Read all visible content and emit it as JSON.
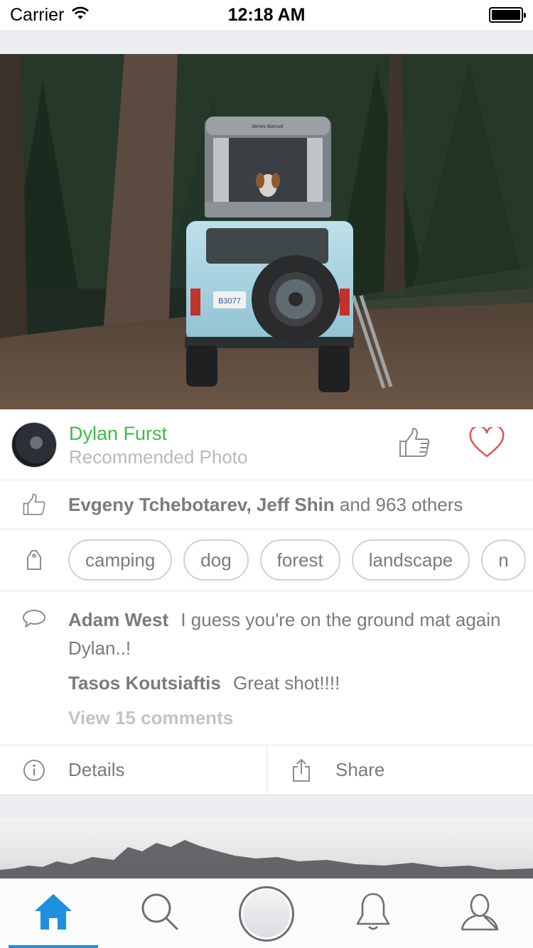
{
  "status_bar": {
    "carrier": "Carrier",
    "time": "12:18 AM"
  },
  "post": {
    "author": {
      "name": "Dylan Furst",
      "subtitle": "Recommended Photo"
    },
    "likes": {
      "names": "Evgeny Tchebotarev, Jeff Shin",
      "rest": " and 963 others"
    },
    "tags": [
      "camping",
      "dog",
      "forest",
      "landscape",
      "n"
    ],
    "comments": [
      {
        "author": "Adam West",
        "text": "I guess you're on the ground mat again Dylan..!"
      },
      {
        "author": "Tasos Koutsiaftis",
        "text": "Great shot!!!!"
      }
    ],
    "view_comments": "View 15 comments",
    "actions": {
      "details": "Details",
      "share": "Share"
    },
    "plate_text": "B3077",
    "rooftop_tent_brand": "James Baroud"
  },
  "colors": {
    "accent_green": "#3dbb4a",
    "heart_red": "#e94b4b",
    "tab_active": "#1f8fe0"
  },
  "icons": [
    "wifi-icon",
    "battery-icon",
    "thumbs-up-icon",
    "heart-icon",
    "tag-icon",
    "comment-icon",
    "info-icon",
    "share-icon",
    "home-icon",
    "search-icon",
    "capture-button",
    "bell-icon",
    "profile-icon"
  ]
}
